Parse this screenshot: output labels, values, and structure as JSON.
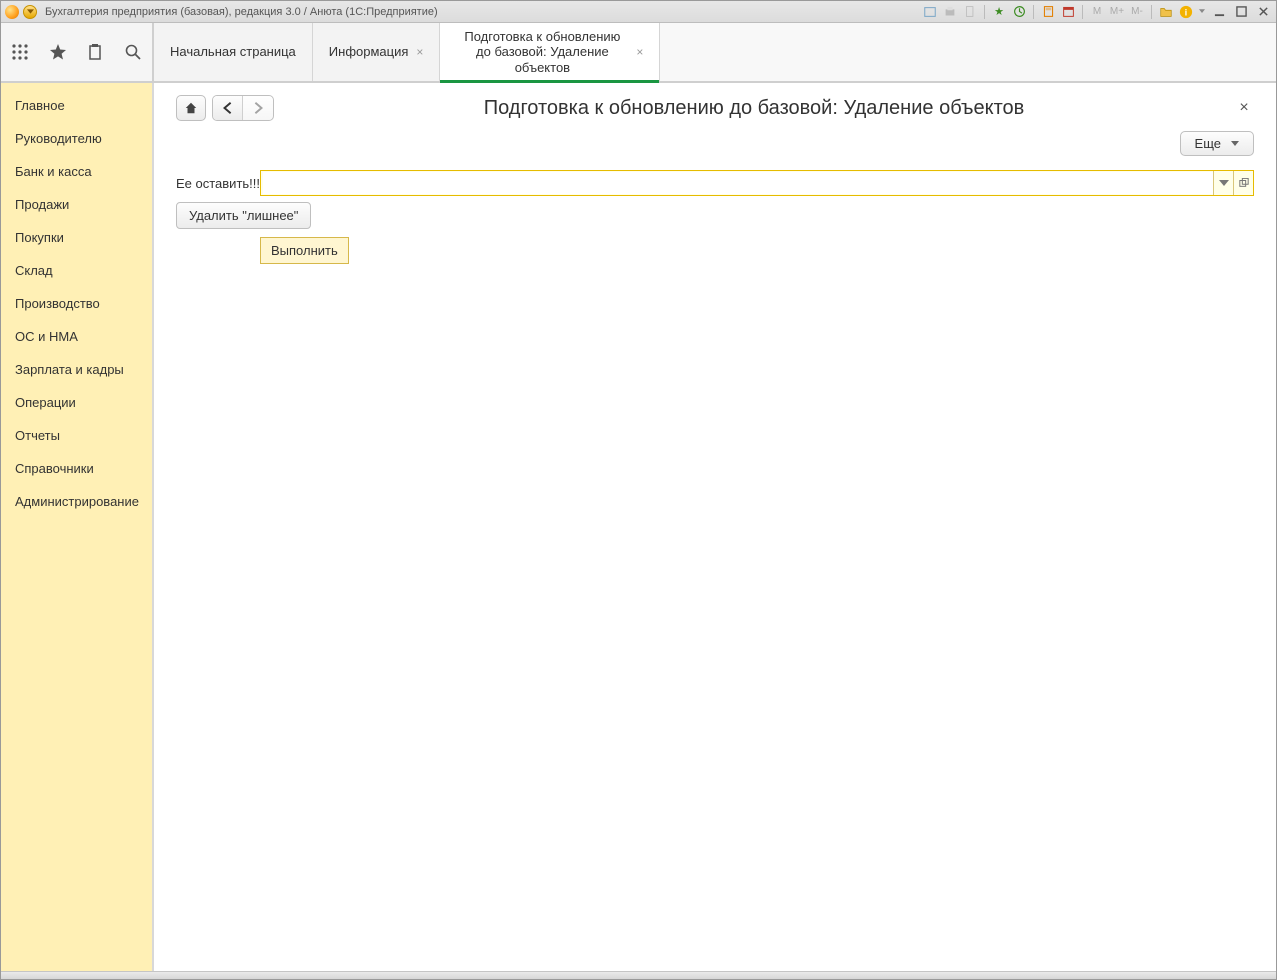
{
  "titlebar": {
    "title": "Бухгалтерия предприятия (базовая), редакция 3.0 / Анюта  (1С:Предприятие)",
    "mem_m": "M",
    "mem_mplus": "M+",
    "mem_mminus": "M-"
  },
  "tabs": [
    {
      "label": "Начальная страница",
      "closable": false,
      "active": false
    },
    {
      "label": "Информация",
      "closable": true,
      "active": false
    },
    {
      "label": "Подготовка к обновлению до базовой: Удаление объектов",
      "closable": true,
      "active": true
    }
  ],
  "sidebar": {
    "items": [
      "Главное",
      "Руководителю",
      "Банк и касса",
      "Продажи",
      "Покупки",
      "Склад",
      "Производство",
      "ОС и НМА",
      "Зарплата и кадры",
      "Операции",
      "Отчеты",
      "Справочники",
      "Администрирование"
    ]
  },
  "page": {
    "title": "Подготовка к обновлению до базовой: Удаление объектов",
    "close_symbol": "×",
    "more_button": "Еще",
    "field_label": "Ее оставить!!!",
    "field_value": "",
    "delete_button": "Удалить \"лишнее\"",
    "execute_button": "Выполнить"
  }
}
